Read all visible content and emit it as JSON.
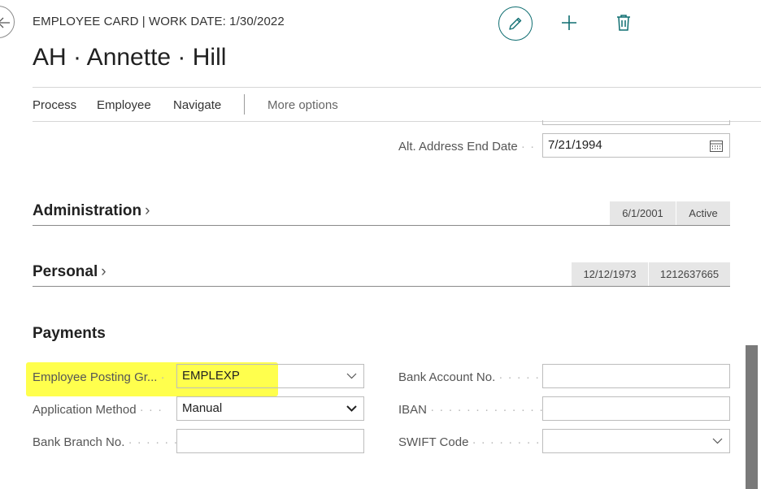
{
  "header": {
    "caption": "EMPLOYEE CARD | WORK DATE: 1/30/2022",
    "title": "AH · Annette · Hill"
  },
  "actions": {
    "process": "Process",
    "employee": "Employee",
    "navigate": "Navigate",
    "more": "More options"
  },
  "alt_address": {
    "label": "Alt. Address End Date",
    "value": "7/21/1994"
  },
  "administration": {
    "title": "Administration",
    "date": "6/1/2001",
    "status": "Active"
  },
  "personal": {
    "title": "Personal",
    "date": "12/12/1973",
    "number": "1212637665"
  },
  "payments": {
    "title": "Payments",
    "posting_group": {
      "label": "Employee Posting Gr...",
      "value": "EMPLEXP"
    },
    "application_method": {
      "label": "Application Method",
      "value": "Manual"
    },
    "bank_branch": {
      "label": "Bank Branch No.",
      "value": ""
    },
    "bank_account": {
      "label": "Bank Account No.",
      "value": ""
    },
    "iban": {
      "label": "IBAN",
      "value": ""
    },
    "swift": {
      "label": "SWIFT Code",
      "value": ""
    }
  },
  "colors": {
    "accent": "#0f6e71",
    "highlight": "#ffff4d"
  }
}
